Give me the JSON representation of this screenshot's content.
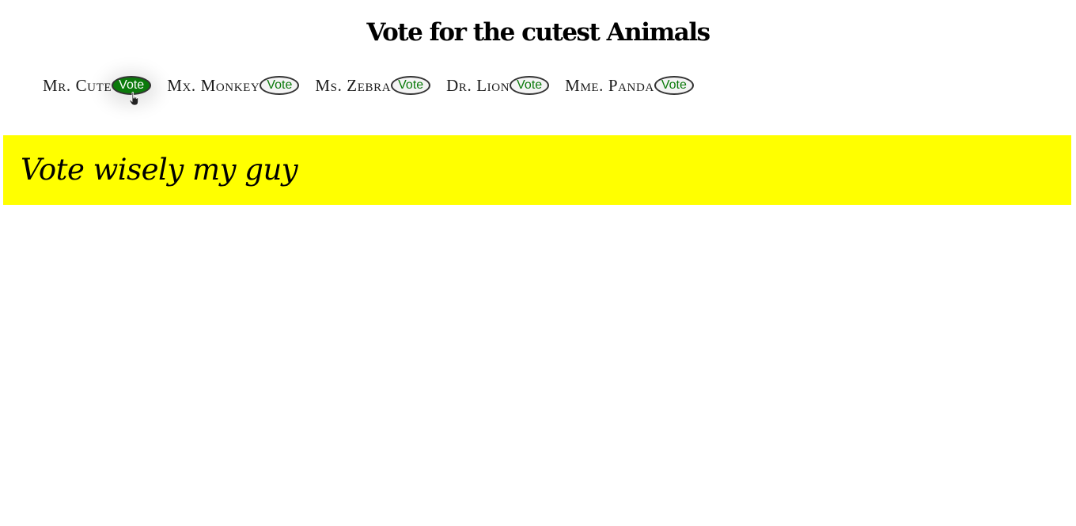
{
  "header": {
    "title": "Vote for the cutest Animals"
  },
  "candidates": [
    {
      "name": "Mr. Cute",
      "vote_label": "Vote",
      "active": true
    },
    {
      "name": "Mx. Monkey",
      "vote_label": "Vote",
      "active": false
    },
    {
      "name": "Ms. Zebra",
      "vote_label": "Vote",
      "active": false
    },
    {
      "name": "Dr. Lion",
      "vote_label": "Vote",
      "active": false
    },
    {
      "name": "Mme. Panda",
      "vote_label": "Vote",
      "active": false
    }
  ],
  "banner": {
    "text": "Vote wisely my guy",
    "color": "#ffff00"
  },
  "colors": {
    "vote_text": "#0a7a0a",
    "vote_active_bg": "#0b7a0b"
  },
  "icons": {
    "cursor": "hand-pointer-icon"
  }
}
